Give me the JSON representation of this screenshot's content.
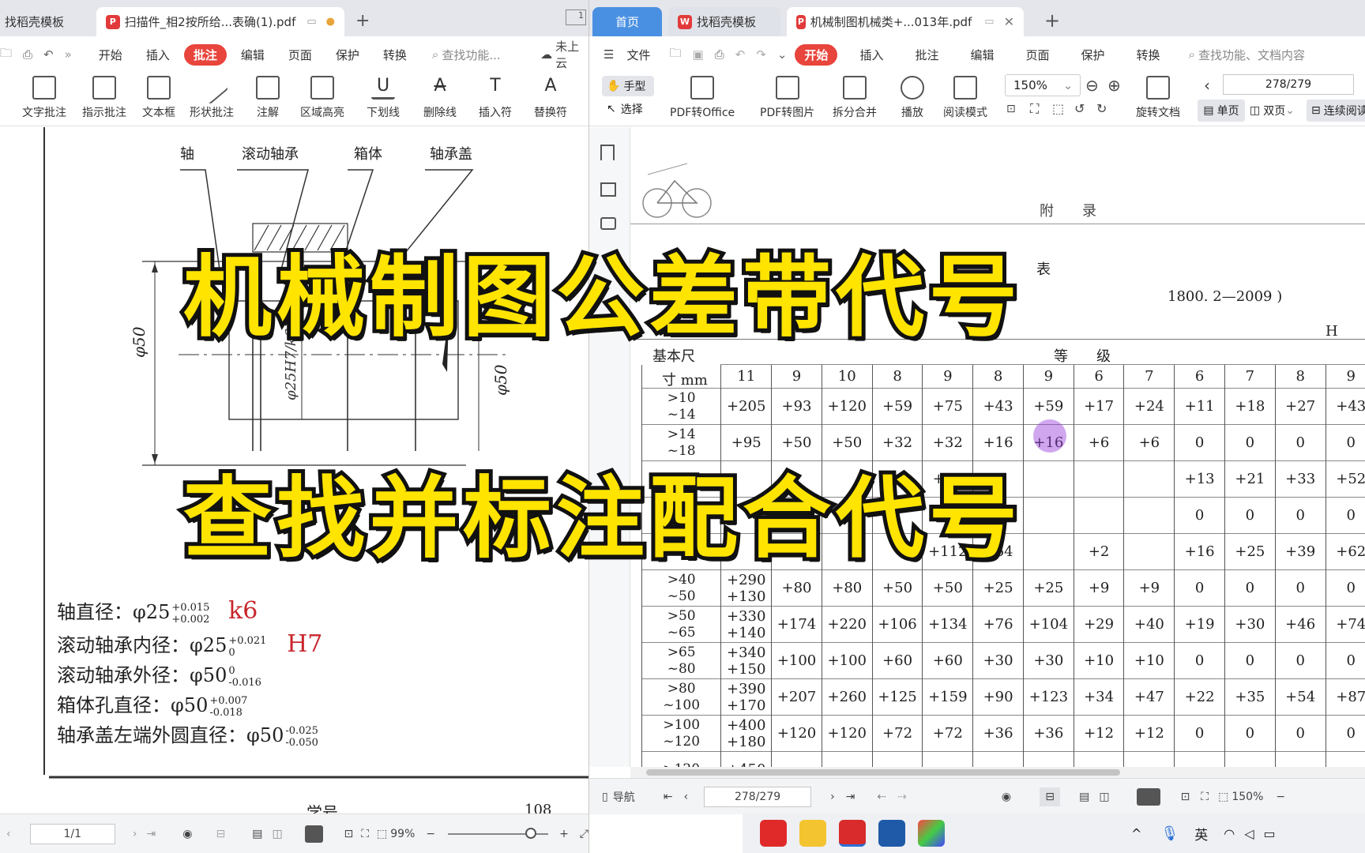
{
  "left_window": {
    "tabs": [
      {
        "label": "找稻壳模板"
      },
      {
        "label": "扫描件_相2按所给...表确(1).pdf"
      }
    ],
    "menu": [
      {
        "label": "开始"
      },
      {
        "label": "插入"
      },
      {
        "label": "批注",
        "selected": true
      },
      {
        "label": "编辑"
      },
      {
        "label": "页面"
      },
      {
        "label": "保护"
      },
      {
        "label": "转换"
      }
    ],
    "search_placeholder": "查找功能...",
    "cloud_label": "未上云",
    "tools": [
      {
        "label": "文字批注"
      },
      {
        "label": "指示批注"
      },
      {
        "label": "文本框"
      },
      {
        "label": "形状批注"
      },
      {
        "label": "注解"
      },
      {
        "label": "区域高亮"
      },
      {
        "label": "下划线"
      },
      {
        "label": "删除线"
      },
      {
        "label": "插入符"
      },
      {
        "label": "替换符"
      }
    ],
    "drawing": {
      "labels": [
        "轴",
        "滚动轴承",
        "箱体",
        "轴承盖"
      ],
      "dim_phi50_left": "φ50",
      "dim_phi25": "φ25H7/k6",
      "dim_phi50_right": "φ50"
    },
    "notes": [
      {
        "label": "轴直径：φ25",
        "upper": "+0.015",
        "lower": "+0.002",
        "code": "k6"
      },
      {
        "label": "滚动轴承内径：φ25",
        "upper": "+0.021",
        "lower": "0",
        "code": "H7"
      },
      {
        "label": "滚动轴承外径：φ50",
        "upper": "0",
        "lower": "-0.016",
        "code": ""
      },
      {
        "label": "箱体孔直径：φ50",
        "upper": "+0.007",
        "lower": "-0.018",
        "code": ""
      },
      {
        "label": "轴承盖左端外圆直径：φ50",
        "upper": "-0.025",
        "lower": "-0.050",
        "code": ""
      }
    ],
    "footer_text": {
      "a": "学号",
      "b": "108"
    },
    "status": {
      "page": "1/1",
      "zoom": "99%"
    }
  },
  "right_window": {
    "tabs": [
      {
        "label": "首页"
      },
      {
        "label": "找稻壳模板"
      },
      {
        "label": "机械制图机械类+...013年.pdf"
      }
    ],
    "menu": [
      {
        "label": "文件"
      },
      {
        "label": "开始",
        "selected": true
      },
      {
        "label": "插入"
      },
      {
        "label": "批注"
      },
      {
        "label": "编辑"
      },
      {
        "label": "页面"
      },
      {
        "label": "保护"
      },
      {
        "label": "转换"
      }
    ],
    "search_placeholder": "查找功能、文档内容",
    "tools": [
      {
        "label": "手型"
      },
      {
        "label": "选择"
      },
      {
        "label": "PDF转Office"
      },
      {
        "label": "PDF转图片"
      },
      {
        "label": "拆分合并"
      },
      {
        "label": "播放"
      },
      {
        "label": "阅读模式"
      },
      {
        "label": "旋转文档"
      },
      {
        "label": "单页"
      },
      {
        "label": "双页"
      },
      {
        "label": "连续阅读"
      }
    ],
    "zoom": "150%",
    "page": "278/279",
    "doc": {
      "appendix": "附　　录",
      "table_caption_partial": "表",
      "standard": "1800. 2—2009 )",
      "header_H": "H",
      "header_basic": "基本尺",
      "header_grade": "等　　级",
      "header_unit": "寸 mm",
      "grades": [
        "11",
        "9",
        "10",
        "8",
        "9",
        "8",
        "9",
        "6",
        "7",
        "6",
        "7",
        "8",
        "9"
      ],
      "rows": [
        {
          "size": [
            ">10",
            "~14"
          ],
          "cells": [
            "+205",
            "+93",
            "+120",
            "+59",
            "+75",
            "+43",
            "+59",
            "+17",
            "+24",
            "+11",
            "+18",
            "+27",
            "+43"
          ]
        },
        {
          "size": [
            ">14",
            "~18"
          ],
          "cells": [
            "+95",
            "+50",
            "+50",
            "+32",
            "+32",
            "+16",
            "+16",
            "+6",
            "+6",
            "0",
            "0",
            "0",
            "0"
          ]
        },
        {
          "size": [
            "",
            ""
          ],
          "cells": [
            "",
            "",
            "",
            "",
            "+92",
            "",
            "",
            "",
            "",
            "+13",
            "+21",
            "+33",
            "+52"
          ]
        },
        {
          "size": [
            "",
            ""
          ],
          "cells": [
            "",
            "",
            "",
            "",
            "",
            "",
            "",
            "",
            "",
            "0",
            "0",
            "0",
            "0"
          ]
        },
        {
          "size": [
            "",
            ""
          ],
          "cells": [
            "",
            "",
            "",
            "",
            "+112",
            "+64",
            "",
            "+2",
            "",
            "+16",
            "+25",
            "+39",
            "+62"
          ]
        },
        {
          "size": [
            ">40",
            "~50"
          ],
          "cells": [
            "+290\n+130",
            "+80",
            "+80",
            "+50",
            "+50",
            "+25",
            "+25",
            "+9",
            "+9",
            "0",
            "0",
            "0",
            "0"
          ]
        },
        {
          "size": [
            ">50",
            "~65"
          ],
          "cells": [
            "+330\n+140",
            "+174",
            "+220",
            "+106",
            "+134",
            "+76",
            "+104",
            "+29",
            "+40",
            "+19",
            "+30",
            "+46",
            "+74"
          ]
        },
        {
          "size": [
            ">65",
            "~80"
          ],
          "cells": [
            "+340\n+150",
            "+100",
            "+100",
            "+60",
            "+60",
            "+30",
            "+30",
            "+10",
            "+10",
            "0",
            "0",
            "0",
            "0"
          ]
        },
        {
          "size": [
            ">80",
            "~100"
          ],
          "cells": [
            "+390\n+170",
            "+207",
            "+260",
            "+125",
            "+159",
            "+90",
            "+123",
            "+34",
            "+47",
            "+22",
            "+35",
            "+54",
            "+87"
          ]
        },
        {
          "size": [
            ">100",
            "~120"
          ],
          "cells": [
            "+400\n+180",
            "+120",
            "+120",
            "+72",
            "+72",
            "+36",
            "+36",
            "+12",
            "+12",
            "0",
            "0",
            "0",
            "0"
          ]
        },
        {
          "size": [
            ">120",
            ""
          ],
          "cells": [
            "+450",
            "",
            "",
            "",
            "",
            "",
            "",
            "",
            "",
            "",
            "",
            "",
            ""
          ]
        }
      ]
    },
    "status": {
      "nav": "导航",
      "page": "278/279",
      "zoom": "150%"
    }
  },
  "overlay": {
    "line1": "机械制图公差带代号",
    "line2": "查找并标注配合代号"
  },
  "taskbar": {
    "ime": "英",
    "apps": [
      "wps-icon",
      "folder-icon",
      "wps-writer-icon",
      "screen-recorder-icon",
      "paint-icon"
    ]
  }
}
